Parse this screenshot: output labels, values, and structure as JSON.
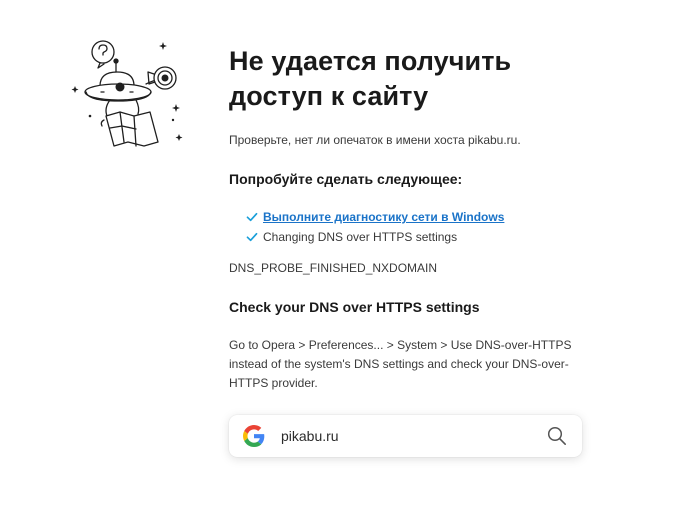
{
  "error_page": {
    "title": "Не удается получить доступ к сайту",
    "hint": "Проверьте, нет ли опечаток в имени хоста pikabu.ru.",
    "try_heading": "Попробуйте сделать следующее:",
    "suggestions": [
      {
        "label": "Выполните диагностику сети в Windows",
        "is_link": true,
        "icon": "check-icon"
      },
      {
        "label": "Changing DNS over HTTPS settings",
        "is_link": false,
        "icon": "check-icon"
      }
    ],
    "error_code": "DNS_PROBE_FINISHED_NXDOMAIN",
    "dns_heading": "Check your DNS over HTTPS settings",
    "dns_text": "Go to Opera > Preferences... > System > Use DNS-over-HTTPS instead of the system's DNS settings and check your DNS-over-HTTPS provider."
  },
  "search": {
    "value": "pikabu.ru",
    "engine_icon": "google-icon",
    "button_icon": "magnifier-icon"
  },
  "colors": {
    "link": "#1a73c8",
    "check": "#1a9fd9",
    "text": "#3a3a3a",
    "heading": "#1a1a1a"
  }
}
